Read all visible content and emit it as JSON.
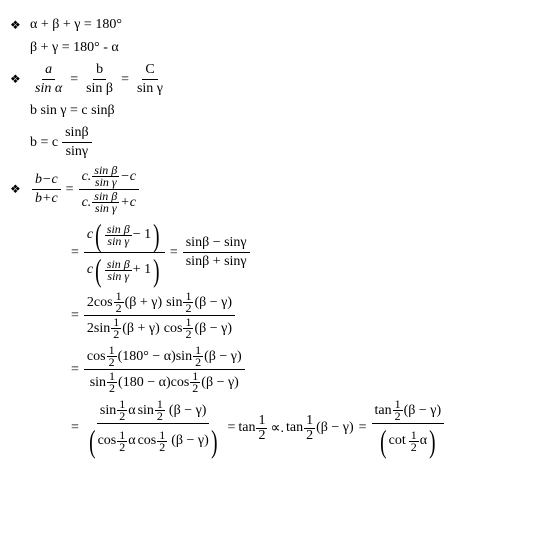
{
  "bullet": "❖",
  "l1": "α + β + γ = 180°",
  "l2": "β + γ = 180° - α",
  "l3": {
    "a": "a",
    "sa": "sin α",
    "b": "b",
    "sb": "sin β",
    "c": "C",
    "sc": "sin γ",
    "eq": "="
  },
  "l4": "b sin γ = c sinβ",
  "l5": {
    "pre": "b = c",
    "n": "sinβ",
    "d": "sinγ"
  },
  "l6": {
    "lhs_n": "b−c",
    "lhs_d": "b+c",
    "rhs_n_pre": "c.",
    "rhs_n_fn": "sin β",
    "rhs_n_fd": "sin γ",
    "rhs_n_post": "−c",
    "rhs_d_pre": "c.",
    "rhs_d_fn": "sin β",
    "rhs_d_fd": "sin γ",
    "rhs_d_post": "+c",
    "eq": "="
  },
  "l7": {
    "eq": "=",
    "c": "c",
    "f_n": "sin β",
    "f_d": "sin γ",
    "m1": "− 1",
    "p1": "+ 1",
    "rn": "sinβ − sinγ",
    "rd": "sinβ + sinγ"
  },
  "l8": {
    "eq": "=",
    "two": "2",
    "cos": "cos",
    "sin": "sin",
    "half_n": "1",
    "half_d": "2",
    "bpg": "(β + γ)",
    "bmg": "(β − γ)"
  },
  "l9": {
    "eq": "=",
    "cos": "cos",
    "sin": "sin",
    "half_n": "1",
    "half_d": "2",
    "a1": "(180° − α)",
    "a2": "(180 − α)",
    "bmg": "(β − γ)"
  },
  "l10": {
    "eq": "=",
    "sin": "sin",
    "cos": "cos",
    "tan": "tan",
    "cot": "cot",
    "half_n": "1",
    "half_d": "2",
    "alpha": "α",
    "prop": "∝.",
    "bmg": "(β − γ)",
    "bmg2": "(β  −  γ)"
  }
}
